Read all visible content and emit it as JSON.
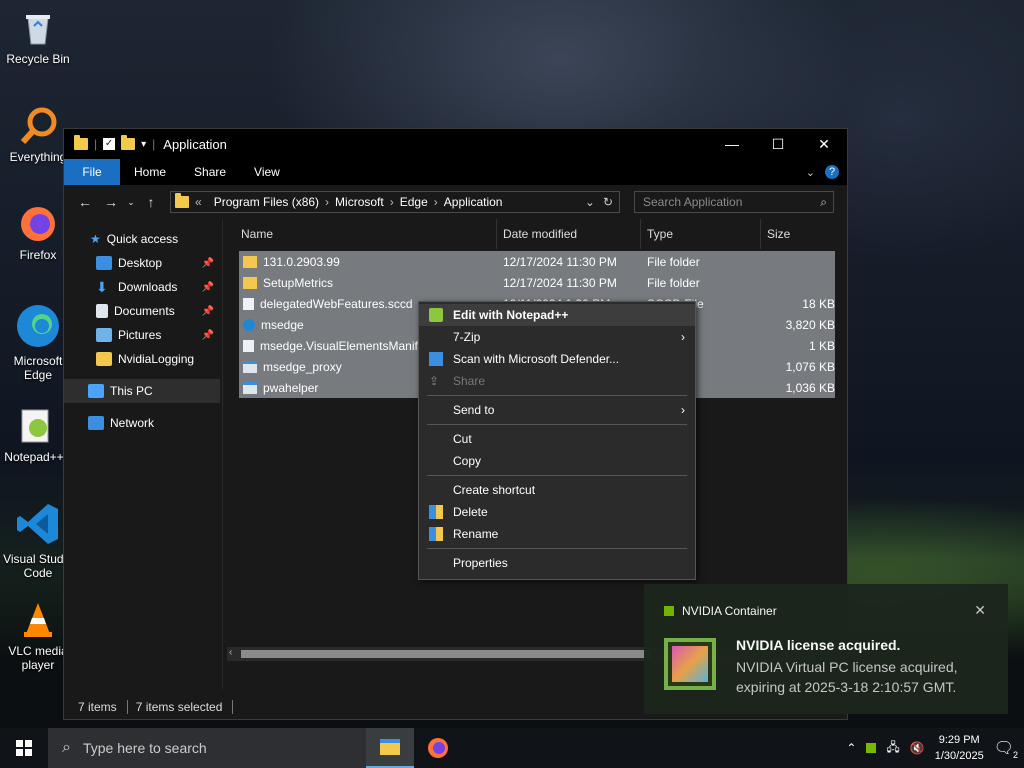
{
  "desktop": {
    "icons": [
      {
        "label": "Recycle Bin"
      },
      {
        "label": "Everything"
      },
      {
        "label": "Firefox"
      },
      {
        "label": "Microsoft Edge"
      },
      {
        "label": "Notepad++"
      },
      {
        "label": "Visual Studio Code"
      },
      {
        "label": "VLC media player"
      }
    ]
  },
  "explorer": {
    "title": "Application",
    "ribbon": {
      "file": "File",
      "home": "Home",
      "share": "Share",
      "view": "View"
    },
    "address": {
      "chevron": "«",
      "segments": [
        "Program Files (x86)",
        "Microsoft",
        "Edge",
        "Application"
      ]
    },
    "search_placeholder": "Search Application",
    "nav": {
      "quick_access": "Quick access",
      "items": [
        "Desktop",
        "Downloads",
        "Documents",
        "Pictures",
        "NvidiaLogging"
      ],
      "this_pc": "This PC",
      "network": "Network"
    },
    "columns": {
      "name": "Name",
      "date": "Date modified",
      "type": "Type",
      "size": "Size"
    },
    "rows": [
      {
        "name": "131.0.2903.99",
        "date": "12/17/2024 11:30 PM",
        "type": "File folder",
        "size": ""
      },
      {
        "name": "SetupMetrics",
        "date": "12/17/2024 11:30 PM",
        "type": "File folder",
        "size": ""
      },
      {
        "name": "delegatedWebFeatures.sccd",
        "date": "12/11/2024 1:30 PM",
        "type": "SCCD File",
        "size": "18 KB"
      },
      {
        "name": "msedge",
        "date": "",
        "type": "ation",
        "size": "3,820 KB"
      },
      {
        "name": "msedge.VisualElementsManif",
        "date": "",
        "type": "ument",
        "size": "1 KB"
      },
      {
        "name": "msedge_proxy",
        "date": "",
        "type": "ation",
        "size": "1,076 KB"
      },
      {
        "name": "pwahelper",
        "date": "",
        "type": "ation",
        "size": "1,036 KB"
      }
    ],
    "status": {
      "count": "7 items",
      "selected": "7 items selected"
    }
  },
  "context_menu": {
    "items": [
      {
        "label": "Edit with Notepad++"
      },
      {
        "label": "7-Zip"
      },
      {
        "label": "Scan with Microsoft Defender..."
      },
      {
        "label": "Share"
      },
      {
        "label": "Send to"
      },
      {
        "label": "Cut"
      },
      {
        "label": "Copy"
      },
      {
        "label": "Create shortcut"
      },
      {
        "label": "Delete"
      },
      {
        "label": "Rename"
      },
      {
        "label": "Properties"
      }
    ]
  },
  "toast": {
    "app": "NVIDIA Container",
    "title": "NVIDIA license acquired.",
    "body": "NVIDIA Virtual PC license acquired, expiring at 2025-3-18 2:10:57 GMT."
  },
  "taskbar": {
    "search_placeholder": "Type here to search",
    "time": "9:29 PM",
    "date": "1/30/2025",
    "notification_count": "2"
  },
  "colors": {
    "accent": "#1a6fc2",
    "folder": "#f2c94c",
    "selection": "#777b80"
  }
}
